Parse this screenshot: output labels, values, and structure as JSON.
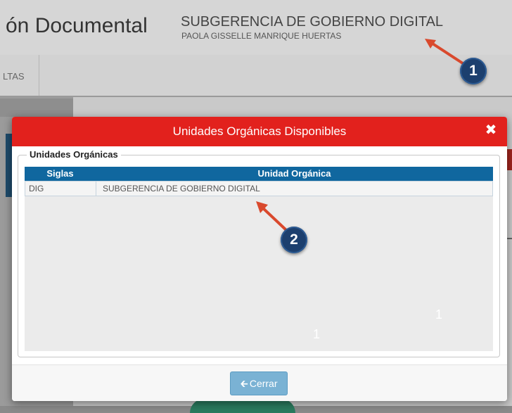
{
  "app": {
    "title": "ón Documental",
    "org_name": "SUBGERENCIA DE GOBIERNO DIGITAL",
    "user_name": "PAOLA GISSELLE MANRIQUE HUERTAS",
    "nav_item": "LTAS"
  },
  "callouts": {
    "one": "1",
    "two": "2"
  },
  "modal": {
    "title": "Unidades Orgánicas Disponibles",
    "fieldset_legend": "Unidades Orgánicas",
    "columns": {
      "siglas": "Siglas",
      "unidad": "Unidad Orgánica"
    },
    "rows": [
      {
        "siglas": "DIG",
        "unidad": "SUBGERENCIA DE GOBIERNO DIGITAL"
      }
    ],
    "close_button": "Cerrar",
    "close_icon": "close-icon",
    "watermarks": [
      "1",
      "1"
    ]
  },
  "colors": {
    "modal_header": "#e2211d",
    "table_header": "#10679f",
    "button": "#7ab2d4",
    "callout_badge": "#1c3f6e",
    "callout_arrow": "#d9492d"
  }
}
